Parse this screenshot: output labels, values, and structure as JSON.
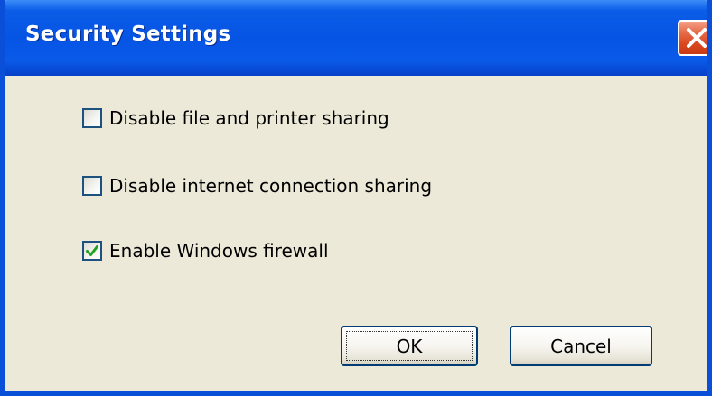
{
  "window": {
    "title": "Security Settings"
  },
  "options": [
    {
      "label": "Disable file and printer sharing",
      "checked": false
    },
    {
      "label": "Disable internet connection sharing",
      "checked": false
    },
    {
      "label": "Enable Windows firewall",
      "checked": true
    }
  ],
  "buttons": {
    "ok_label": "OK",
    "cancel_label": "Cancel"
  },
  "icons": {
    "close": "close-icon",
    "check": "checkmark-icon"
  },
  "colors": {
    "titlebar": "#0654e4",
    "frame": "#0a4fd8",
    "close_button": "#d9471f",
    "dialog_bg": "#ece9d8",
    "checkbox_border": "#1c5180",
    "checkmark": "#21a121"
  }
}
